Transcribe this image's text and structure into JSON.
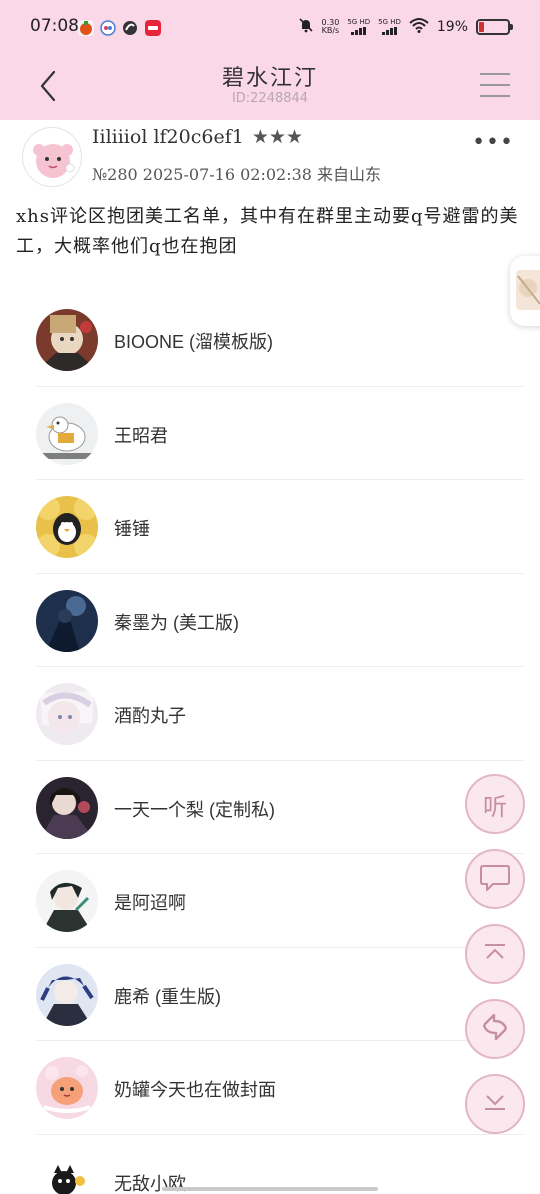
{
  "status_bar": {
    "time": "07:08",
    "net_speed": "0.30",
    "net_unit": "KB/s",
    "sim1": "5G HD",
    "sim2": "5G HD",
    "battery_pct": "19%",
    "battery_level": 0.19
  },
  "header": {
    "title": "碧水江汀",
    "id_text": "ID:2248844",
    "back_icon": "back-arrow-icon",
    "menu_icon": "hamburger-menu-icon"
  },
  "post": {
    "author": "Iiliiiol lf20c6ef1",
    "stars": "★★★",
    "more": "•••",
    "meta": "№280 2025-07-16 02:02:38 来自山东",
    "body": "xhs评论区抱团美工名单，其中有在群里主动要q号避雷的美工，大概率他们q也在抱团"
  },
  "list": [
    {
      "name": "BIOONE (溜模板版)"
    },
    {
      "name": "王昭君"
    },
    {
      "name": "锤锤"
    },
    {
      "name": "秦墨为 (美工版)"
    },
    {
      "name": "酒酌丸子"
    },
    {
      "name": "一天一个梨 (定制私)"
    },
    {
      "name": "是阿迢啊"
    },
    {
      "name": "鹿希 (重生版)"
    },
    {
      "name": "奶罐今天也在做封面"
    },
    {
      "name": "无敌小欧."
    }
  ],
  "fabs": {
    "listen_label": "听",
    "icons": [
      "listen-icon",
      "comment-icon",
      "scroll-top-icon",
      "refresh-icon",
      "scroll-bottom-icon"
    ]
  },
  "colors": {
    "header_bg": "#fbd8e8",
    "fab_border": "#e3b6c5",
    "fab_fill": "#fbe8ef"
  }
}
